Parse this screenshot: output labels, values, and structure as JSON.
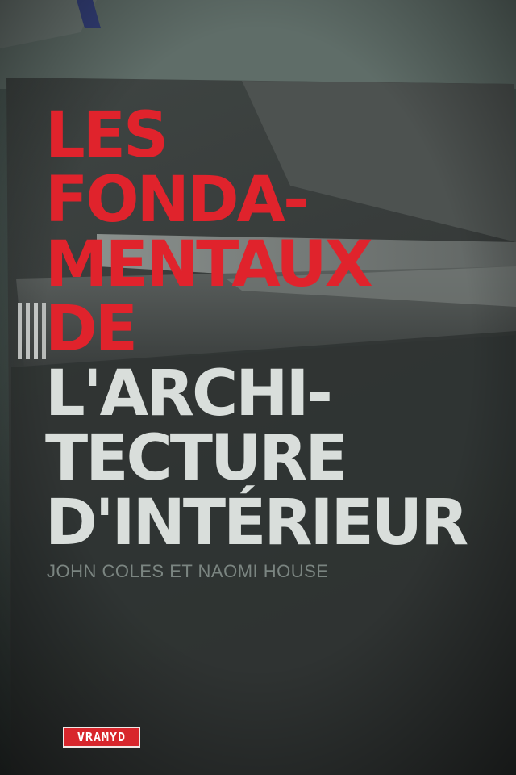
{
  "cover": {
    "title_red": [
      "LES",
      "FONDA-",
      "MENTAUX",
      "DE"
    ],
    "title_white": [
      "L'ARCHI-",
      "TECTURE",
      "D'INTÉRIEUR"
    ],
    "authors": "JOHN COLES ET NAOMI HOUSE",
    "publisher": "VRAMYD"
  },
  "colors": {
    "title_red": "#e0232c",
    "title_white": "#d9dedb",
    "authors_gray": "#7b8581",
    "publisher_badge": "#d8262c",
    "book_cover": "#3a3d3c",
    "background_wall": "#5d6b66"
  }
}
